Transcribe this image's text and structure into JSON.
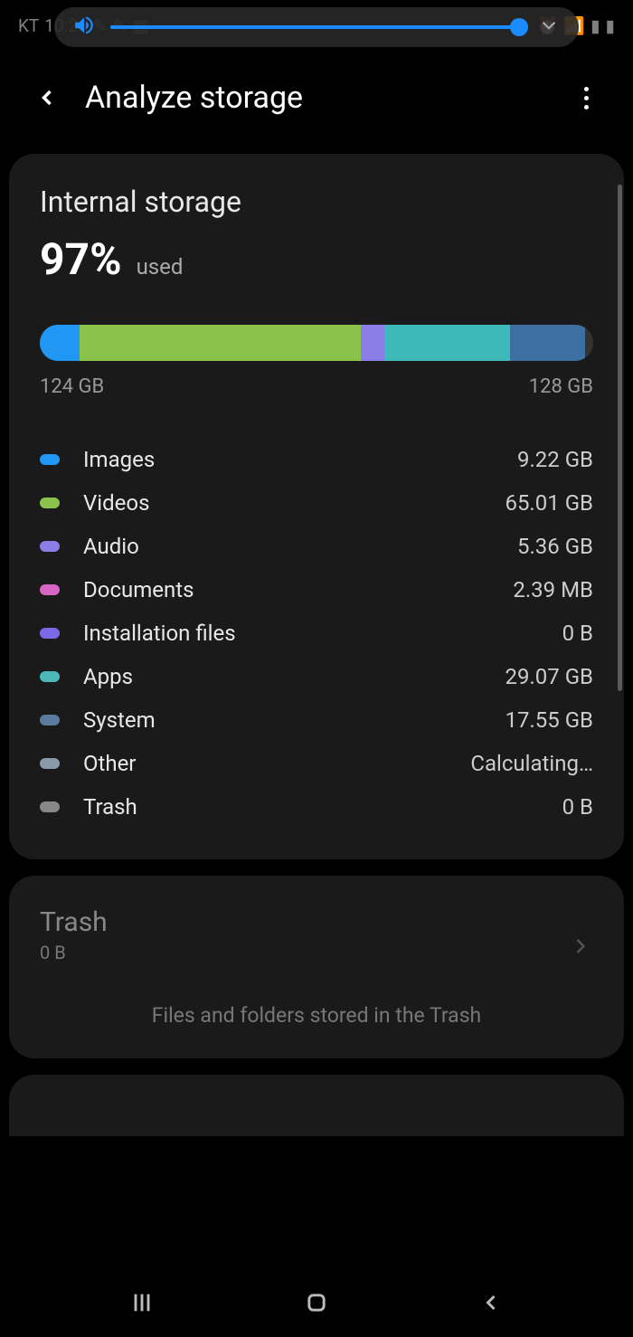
{
  "status": {
    "carrier": "KT",
    "time": "10:26"
  },
  "header": {
    "title": "Analyze storage"
  },
  "storage": {
    "title": "Internal storage",
    "percent": "97%",
    "used_label": "used",
    "used_gb": "124 GB",
    "total_gb": "128 GB",
    "segments": [
      {
        "color": "#2196f3",
        "width": 7.2
      },
      {
        "color": "#8bc34a",
        "width": 50.8
      },
      {
        "color": "#8b7de8",
        "width": 4.2
      },
      {
        "color": "#3eb8b8",
        "width": 22.7
      },
      {
        "color": "#3d6fa3",
        "width": 13.7
      }
    ],
    "categories": [
      {
        "label": "Images",
        "size": "9.22 GB",
        "color": "#2196f3"
      },
      {
        "label": "Videos",
        "size": "65.01 GB",
        "color": "#8bc34a"
      },
      {
        "label": "Audio",
        "size": "5.36 GB",
        "color": "#8b7de8"
      },
      {
        "label": "Documents",
        "size": "2.39 MB",
        "color": "#d864c4"
      },
      {
        "label": "Installation files",
        "size": "0 B",
        "color": "#7a6ae8"
      },
      {
        "label": "Apps",
        "size": "29.07 GB",
        "color": "#4db8b8"
      },
      {
        "label": "System",
        "size": "17.55 GB",
        "color": "#5a7a9e"
      },
      {
        "label": "Other",
        "size": "Calculating…",
        "color": "#8899aa"
      },
      {
        "label": "Trash",
        "size": "0 B",
        "color": "#888888"
      }
    ]
  },
  "trash": {
    "title": "Trash",
    "size": "0 B",
    "desc": "Files and folders stored in the Trash"
  }
}
